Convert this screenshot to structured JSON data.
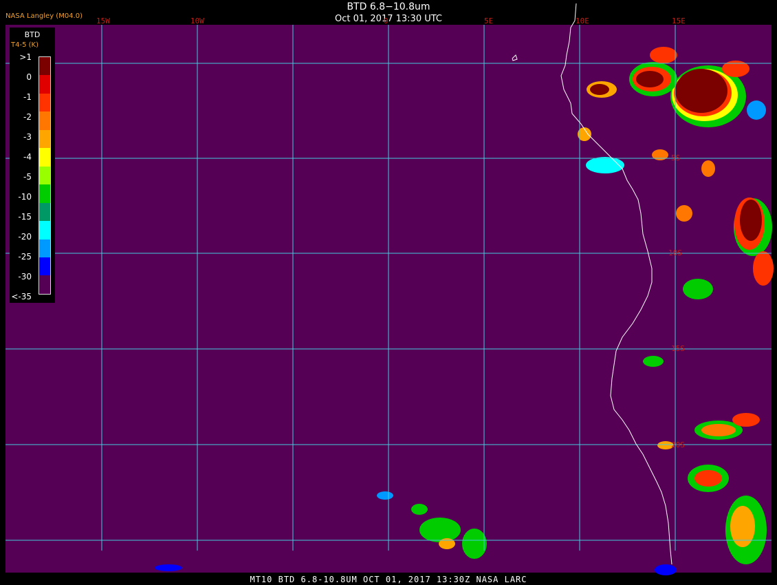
{
  "header": {
    "title": "BTD 6.8−10.8um",
    "subtitle": "Oct 01, 2017 13:30 UTC",
    "credit": "NASA Langley (M04.0)"
  },
  "legend": {
    "title": "BTD",
    "unit": "T4-5 (K)",
    "ticks": [
      ">1",
      "0",
      "-1",
      "-2",
      "-3",
      "-4",
      "-5",
      "-10",
      "-15",
      "-20",
      "-25",
      "-30",
      "<-35"
    ],
    "colors": [
      "#7b0000",
      "#e00000",
      "#ff3300",
      "#ff7700",
      "#ffa500",
      "#ffff00",
      "#99ff00",
      "#00cc00",
      "#009966",
      "#00ffff",
      "#0099ff",
      "#0000ff",
      "#550055"
    ]
  },
  "map": {
    "background_color": "#550055",
    "grid_color": "#44ccdd",
    "coast_color": "#ffffff",
    "lon_labels": [
      "15W",
      "10W",
      "0",
      "5E",
      "10E",
      "15E"
    ],
    "lat_labels": [
      "5S",
      "10S",
      "15S",
      "20S"
    ]
  },
  "footer": {
    "text": "MT10  BTD 6.8-10.8UM   OCT 01, 2017 13:30Z   NASA LARC"
  }
}
